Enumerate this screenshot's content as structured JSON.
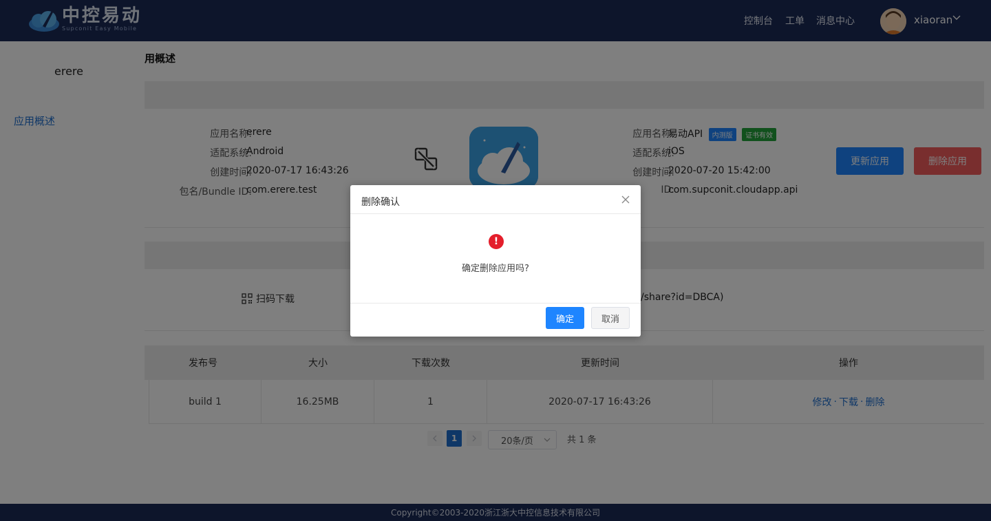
{
  "header": {
    "logo_title": "中控易动",
    "logo_sub": "Supconit Easy Mobile",
    "nav": [
      "控制台",
      "工单",
      "消息中心"
    ],
    "username": "xiaoran"
  },
  "sidebar": {
    "app_name": "erere",
    "items": [
      {
        "label": "应用概述"
      }
    ]
  },
  "main": {
    "page_title": "用概述",
    "left_app": {
      "name_label": "应用名称:",
      "name": "erere",
      "system_label": "适配系统:",
      "system": "Android",
      "created_label": "创建时间:",
      "created": "2020-07-17 16:43:26",
      "bundle_label": "包名/Bundle ID:",
      "bundle": "com.erere.test"
    },
    "right_app": {
      "name_label": "应用名称:",
      "name": "易动API",
      "badge_beta": "内测版",
      "badge_cert": "证书有效",
      "system_label": "适配系统:",
      "system": "iOS",
      "created_label": "创建时间:",
      "created": "2020-07-20 15:42:00",
      "bundle_label": "ID:",
      "bundle": "com.supconit.cloudapp.api"
    },
    "update_button": "更新应用",
    "delete_button": "删除应用",
    "scan_download": "扫码下载",
    "share_url": "/share?id=DBCA)",
    "table": {
      "headers": [
        "发布号",
        "大小",
        "下载次数",
        "更新时间",
        "操作"
      ],
      "rows": [
        {
          "build": "build 1",
          "size": "16.25MB",
          "downloads": "1",
          "updated": "2020-07-17 16:43:26"
        }
      ],
      "ops": [
        "修改",
        "下载",
        "删除"
      ],
      "op_sep": "·"
    },
    "pagination": {
      "current": "1",
      "page_size": "20条/页",
      "total": "共 1 条"
    }
  },
  "footer": "Copyright©2003-2020浙江浙大中控信息技术有限公司",
  "dialog": {
    "title": "删除确认",
    "message": "确定删除应用吗?",
    "ok": "确定",
    "cancel": "取消"
  },
  "colors": {
    "brand": "#1b2a57",
    "accent": "#1f6fce",
    "danger": "#e41e2b",
    "update_btn": "#1e85ff",
    "delete_btn": "#f25c5c",
    "badge_beta": "#1e85ff",
    "badge_cert": "#22a33a"
  }
}
